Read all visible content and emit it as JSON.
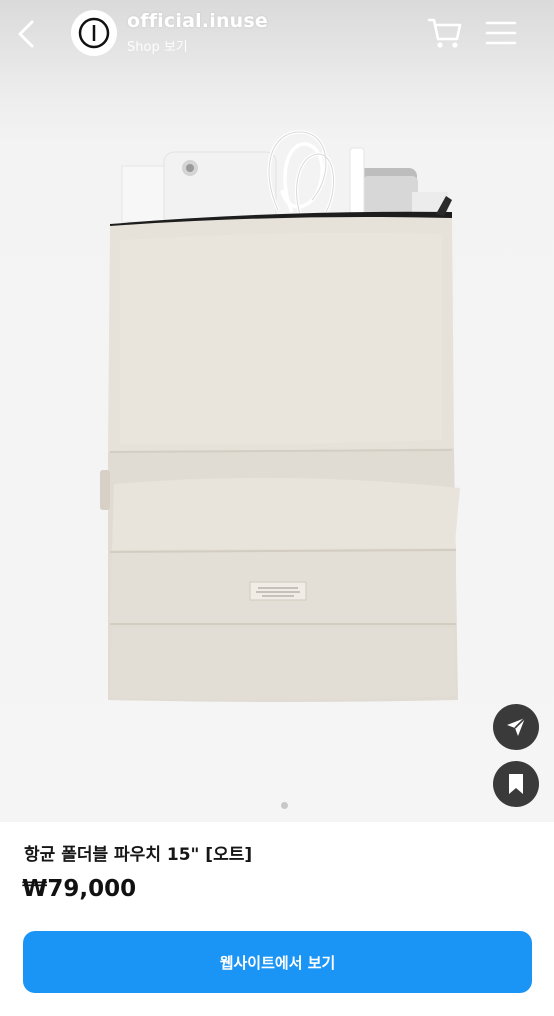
{
  "header": {
    "account_name": "official.inuse",
    "account_subtitle": "Shop 보기",
    "avatar_icon": "inuse-logo-icon",
    "back_icon": "chevron-left-icon",
    "cart_icon": "cart-icon",
    "menu_icon": "hamburger-menu-icon"
  },
  "media": {
    "image_description_icon": "product-photo",
    "carousel_count": 1,
    "carousel_active": 1
  },
  "actions": {
    "share_icon": "send-icon",
    "save_icon": "bookmark-icon"
  },
  "product": {
    "title": "항균 폴더블 파우치 15\" [오트]",
    "price": "₩79,000"
  },
  "cta": {
    "label": "웹사이트에서 보기",
    "color": "#1b95f5"
  }
}
